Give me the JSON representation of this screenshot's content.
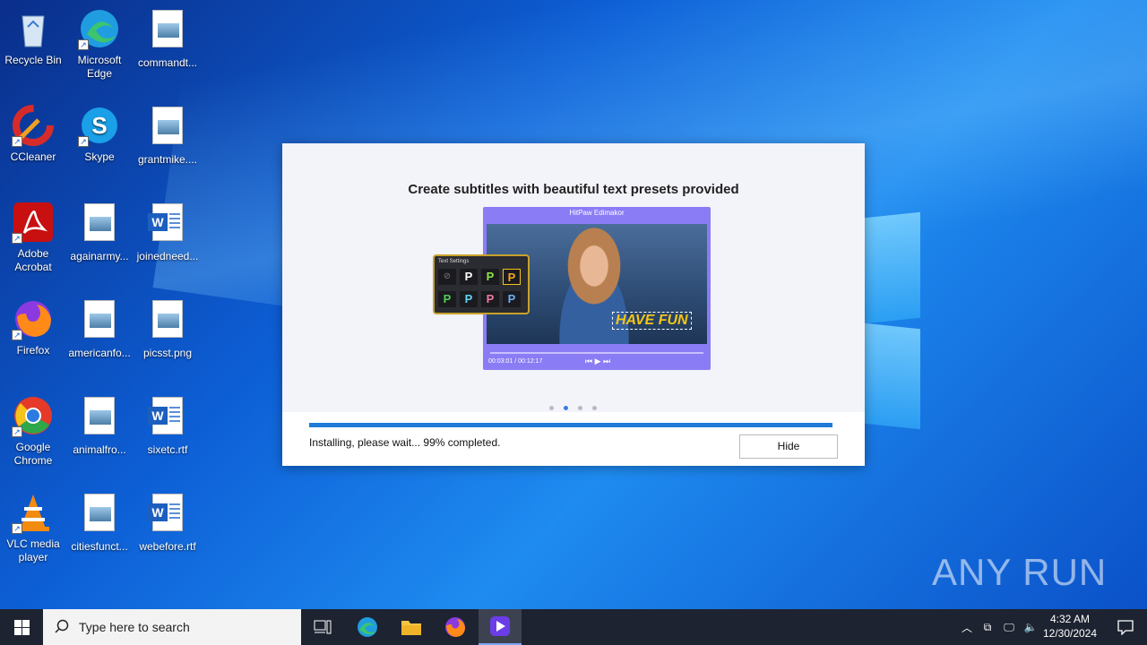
{
  "desktop": {
    "icons": [
      {
        "label": "Recycle Bin"
      },
      {
        "label": "Microsoft Edge"
      },
      {
        "label": "commandt..."
      },
      {
        "label": "CCleaner"
      },
      {
        "label": "Skype"
      },
      {
        "label": "grantmike...."
      },
      {
        "label": "Adobe Acrobat"
      },
      {
        "label": "againarmy..."
      },
      {
        "label": "joinedneed..."
      },
      {
        "label": "Firefox"
      },
      {
        "label": "americanfo..."
      },
      {
        "label": "picsst.png"
      },
      {
        "label": "Google Chrome"
      },
      {
        "label": "animalfro..."
      },
      {
        "label": "sixetc.rtf"
      },
      {
        "label": "VLC media player"
      },
      {
        "label": "citiesfunct..."
      },
      {
        "label": "webefore.rtf"
      }
    ]
  },
  "installer": {
    "slide_title": "Create subtitles with beautiful text presets provided",
    "preview_app_title": "HitPaw Edimakor",
    "preview_caption": "HAVE FUN",
    "text_settings_label": "Text Settings",
    "text_presets": [
      "P",
      "P",
      "P",
      "P",
      "P",
      "P",
      "P"
    ],
    "preview_time": "00:03:01 / 00:12:17",
    "carousel_active_index": 1,
    "progress_percent": 99,
    "status_text": "Installing, please wait... 99% completed.",
    "hide_label": "Hide"
  },
  "watermark": {
    "text": "ANY RUN"
  },
  "taskbar": {
    "search_placeholder": "Type here to search",
    "time": "4:32 AM",
    "date": "12/30/2024"
  }
}
